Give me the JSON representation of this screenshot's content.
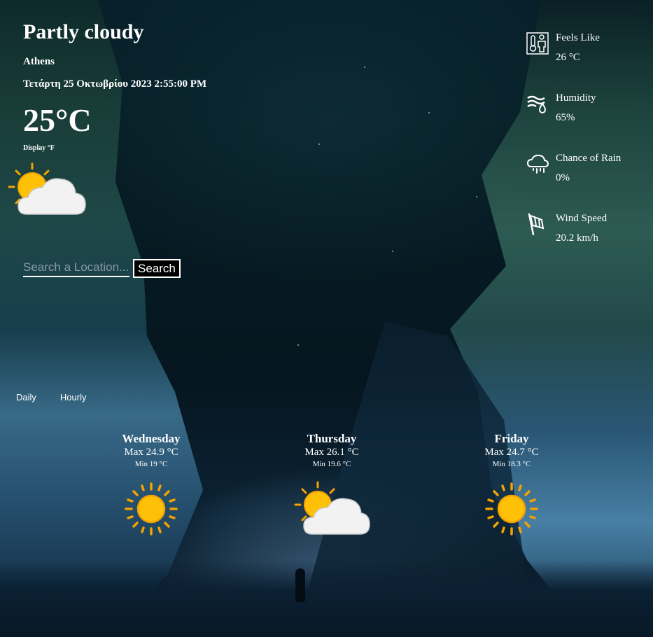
{
  "current": {
    "condition": "Partly cloudy",
    "city": "Athens",
    "datetime": "Τετάρτη 25 Οκτωβρίου 2023 2:55:00 PM",
    "temperature": "25°C",
    "unit_toggle": "Display °F",
    "icon": "partly-cloudy-icon"
  },
  "search": {
    "placeholder": "Search a Location...",
    "value": "",
    "button_label": "Search"
  },
  "stats": [
    {
      "label": "Feels Like",
      "value": "26 °C",
      "icon": "thermometer-person-icon"
    },
    {
      "label": "Humidity",
      "value": "65%",
      "icon": "humidity-icon"
    },
    {
      "label": "Chance of Rain",
      "value": "0%",
      "icon": "rain-cloud-icon"
    },
    {
      "label": "Wind Speed",
      "value": "20.2 km/h",
      "icon": "windsock-icon"
    }
  ],
  "tabs": {
    "daily": "Daily",
    "hourly": "Hourly"
  },
  "forecast": [
    {
      "day": "Wednesday",
      "max": "Max 24.9 °C",
      "min": "Min 19 °C",
      "icon": "sunny-icon"
    },
    {
      "day": "Thursday",
      "max": "Max 26.1 °C",
      "min": "Min 19.6 °C",
      "icon": "partly-cloudy-icon"
    },
    {
      "day": "Friday",
      "max": "Max 24.7 °C",
      "min": "Min 18.3 °C",
      "icon": "sunny-icon"
    }
  ],
  "colors": {
    "text": "#ffffff",
    "sun": "#ffc107",
    "sun_ray": "#f4a300",
    "cloud": "#f2f2f2",
    "background": "#06151d"
  }
}
